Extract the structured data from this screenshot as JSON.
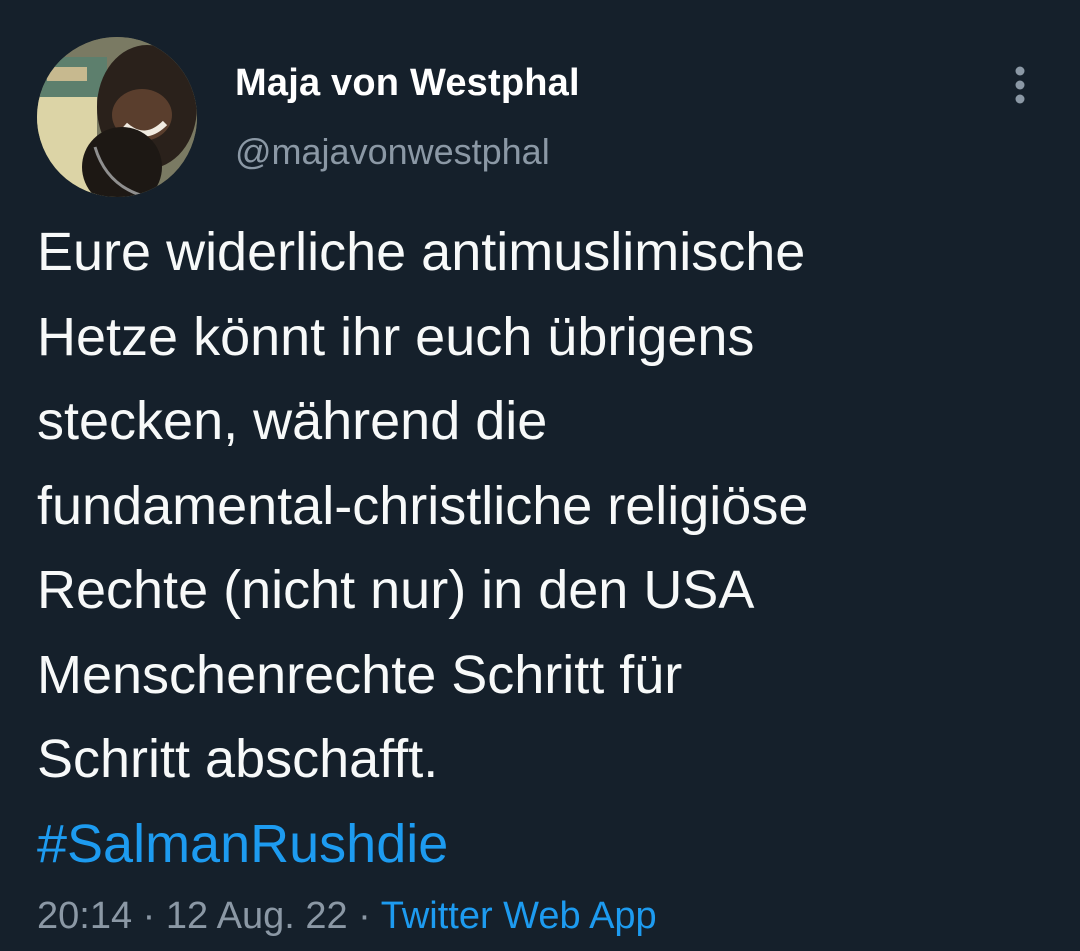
{
  "author": {
    "name": "Maja von Westphal",
    "handle": "@majavonwestphal"
  },
  "tweet": {
    "lines": [
      "Eure widerliche antimuslimische",
      "Hetze könnt ihr euch übrigens",
      "stecken, während die",
      "fundamental-christliche religiöse",
      "Rechte (nicht nur) in den USA",
      "Menschenrechte Schritt für",
      "Schritt abschafft."
    ],
    "hashtag": "#SalmanRushdie"
  },
  "meta": {
    "time": "20:14",
    "separator_1": " · ",
    "date": "12 Aug. 22",
    "separator_2": " · ",
    "source": "Twitter Web App"
  },
  "icons": {
    "more": "more-vertical-icon"
  },
  "colors": {
    "background": "#15202b",
    "text": "#f7f9f9",
    "secondary": "#8b98a5",
    "link": "#1d9bf0"
  }
}
